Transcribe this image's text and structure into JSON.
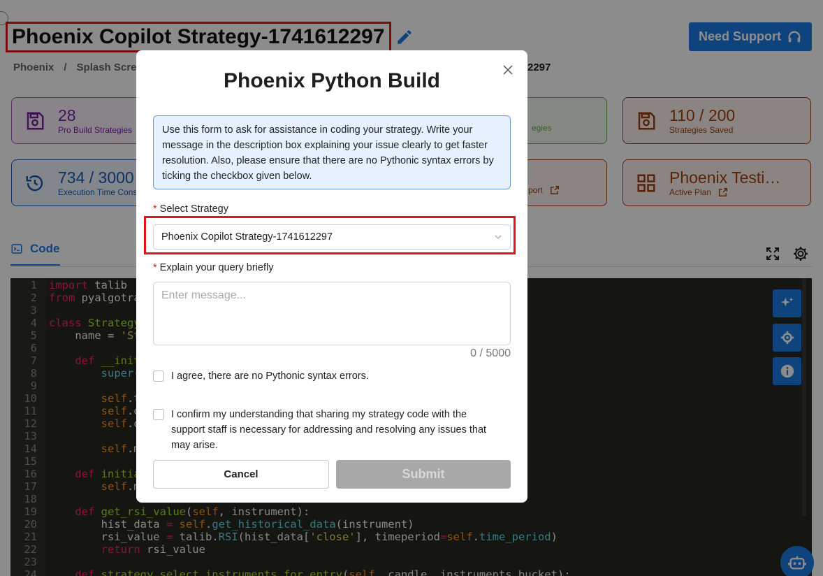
{
  "header": {
    "title": "Phoenix Copilot Strategy-1741612297",
    "support_label": "Need Support"
  },
  "breadcrumb": {
    "items": [
      "Phoenix",
      "/",
      "Splash Scree"
    ],
    "tail": "2297"
  },
  "stats": [
    {
      "value": "28",
      "label": "Pro Build Strategies",
      "color": "#7b1fa2"
    },
    {
      "value": "",
      "label": "egies",
      "color": "#6aa84f"
    },
    {
      "value": "110 / 200",
      "label": "Strategies Saved",
      "color": "#a04015"
    },
    {
      "value": "734 / 3000",
      "label": "Execution Time Cons",
      "color": "#1a5bb5"
    },
    {
      "value": "",
      "label": "port",
      "color": "#a04015"
    },
    {
      "value": "Phoenix Testi…",
      "label": "Active Plan",
      "color": "#a04015"
    }
  ],
  "code_tab": {
    "label": "Code"
  },
  "editor": {
    "line_numbers": [
      "1",
      "2",
      "3",
      "4",
      "5",
      "6",
      "7",
      "8",
      "9",
      "10",
      "11",
      "12",
      "13",
      "14",
      "15",
      "16",
      "17",
      "18",
      "19",
      "20",
      "21",
      "22",
      "23",
      "24"
    ]
  },
  "modal": {
    "title": "Phoenix Python Build",
    "info": "Use this form to ask for assistance in coding your strategy. Write your message in the description box explaining your issue clearly to get faster resolution. Also, please ensure that there are no Pythonic syntax errors by ticking the checkbox given below.",
    "strategy_label": "Select Strategy",
    "strategy_value": "Phoenix Copilot Strategy-1741612297",
    "query_label": "Explain your query briefly",
    "query_placeholder": "Enter message...",
    "char_count": "0 / 5000",
    "check1": "I agree, there are no Pythonic syntax errors.",
    "check2": "I confirm my understanding that sharing my strategy code with the support staff is necessary for addressing and resolving any issues that may arise.",
    "cancel_label": "Cancel",
    "submit_label": "Submit"
  },
  "colors": {
    "accent": "#1a7be6",
    "highlight": "#e5141b",
    "editor_bg": "#272822"
  }
}
